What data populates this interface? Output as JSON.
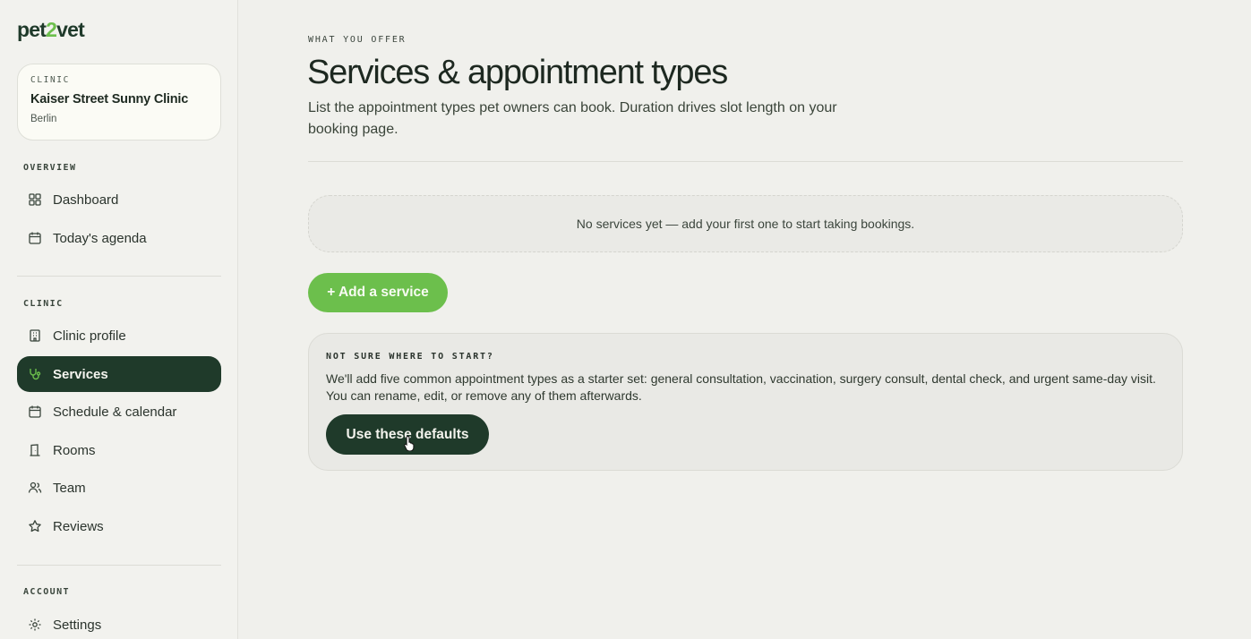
{
  "brand": {
    "name_pre": "pet",
    "name_mid": "2",
    "name_post": "vet"
  },
  "clinic": {
    "eyebrow": "CLINIC",
    "name": "Kaiser Street Sunny Clinic",
    "city": "Berlin"
  },
  "sidebar": {
    "sections": [
      {
        "label": "OVERVIEW",
        "items": [
          {
            "label": "Dashboard",
            "icon": "dashboard-icon"
          },
          {
            "label": "Today's agenda",
            "icon": "calendar-icon"
          }
        ]
      },
      {
        "label": "CLINIC",
        "items": [
          {
            "label": "Clinic profile",
            "icon": "building-icon"
          },
          {
            "label": "Services",
            "icon": "stethoscope-icon",
            "active": true
          },
          {
            "label": "Schedule & calendar",
            "icon": "calendar-icon"
          },
          {
            "label": "Rooms",
            "icon": "door-icon"
          },
          {
            "label": "Team",
            "icon": "team-icon"
          },
          {
            "label": "Reviews",
            "icon": "star-icon"
          }
        ]
      },
      {
        "label": "ACCOUNT",
        "items": [
          {
            "label": "Settings",
            "icon": "gear-icon"
          }
        ]
      }
    ]
  },
  "main": {
    "eyebrow": "WHAT YOU OFFER",
    "title": "Services & appointment types",
    "subtitle": "List the appointment types pet owners can book. Duration drives slot length on your booking page.",
    "empty_message": "No services yet — add your first one to start taking bookings.",
    "add_button": "+ Add a service",
    "starter": {
      "eyebrow": "NOT SURE WHERE TO START?",
      "text": "We'll add five common appointment types as a starter set: general consultation, vaccination, surgery consult, dental check, and urgent same-day visit. You can rename, edit, or remove any of them afterwards.",
      "button": "Use these defaults"
    }
  },
  "colors": {
    "brand_dark": "#1f3a2a",
    "brand_green": "#6cbf4c",
    "background": "#f0f0ec"
  }
}
